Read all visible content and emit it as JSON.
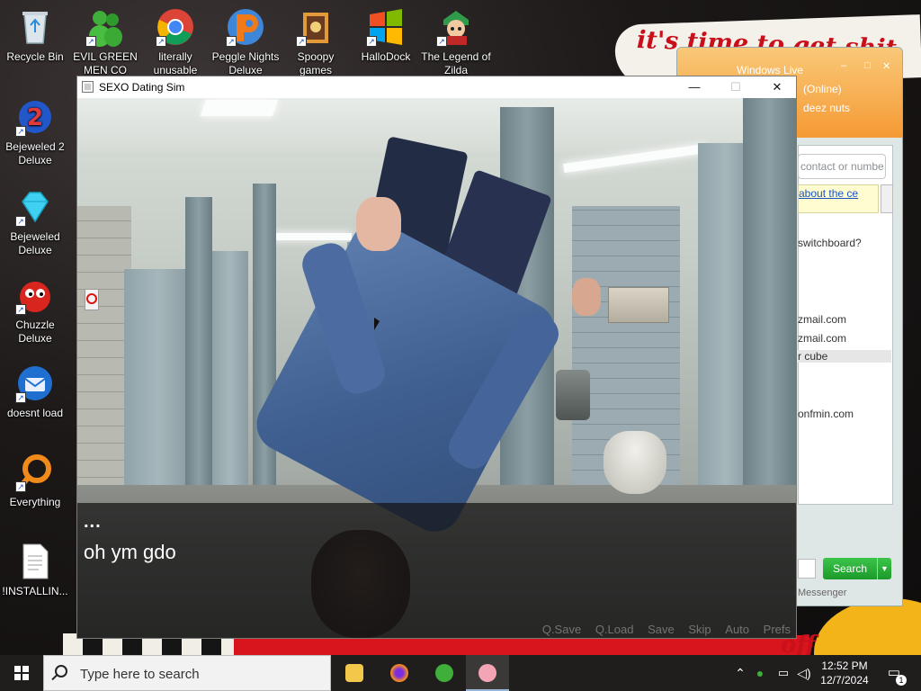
{
  "wallpaper": {
    "banner_text": "it's time to get shit",
    "bottom_text": "off"
  },
  "desktop_icons": [
    {
      "label": "Recycle Bin",
      "icon": "recycle-bin-icon"
    },
    {
      "label": "EVIL GREEN MEN CO",
      "icon": "green-men-icon"
    },
    {
      "label": "literally unusable",
      "icon": "chrome-icon"
    },
    {
      "label": "Peggle Nights Deluxe",
      "icon": "peggle-icon"
    },
    {
      "label": "Spoopy games",
      "icon": "spoopy-icon"
    },
    {
      "label": "HalloDock",
      "icon": "windows-logo-icon"
    },
    {
      "label": "The Legend of Zilda",
      "icon": "zilda-icon"
    },
    {
      "label": "Bejeweled 2 Deluxe",
      "icon": "bejeweled2-icon"
    },
    {
      "label": "Bejeweled Deluxe",
      "icon": "diamond-icon"
    },
    {
      "label": "Chuzzle Deluxe",
      "icon": "chuzzle-icon"
    },
    {
      "label": "doesnt load",
      "icon": "thunderbird-icon"
    },
    {
      "label": "Everything",
      "icon": "everything-icon"
    },
    {
      "label": "!INSTALLIN...",
      "icon": "document-icon"
    }
  ],
  "messenger": {
    "title": "Windows Live",
    "status": "(Online)",
    "name": "deez nuts",
    "search_placeholder": "contact or numbe",
    "notice": "about the ce",
    "items": [
      "switchboard?",
      "zmail.com",
      "zmail.com",
      "r cube",
      "onfmin.com"
    ],
    "search_button": "Search",
    "footer": "Messenger"
  },
  "game_window": {
    "title": "SEXO Dating Sim",
    "speaker": "...",
    "dialogue": "oh ym gdo",
    "quick_menu": [
      "Q.Save",
      "Q.Load",
      "Save",
      "Skip",
      "Auto",
      "Prefs"
    ]
  },
  "taskbar": {
    "search_placeholder": "Type here to search",
    "apps": [
      "file-explorer",
      "firefox",
      "messenger",
      "dating-sim"
    ],
    "time": "12:52 PM",
    "date": "12/7/2024",
    "notification_count": "1"
  }
}
